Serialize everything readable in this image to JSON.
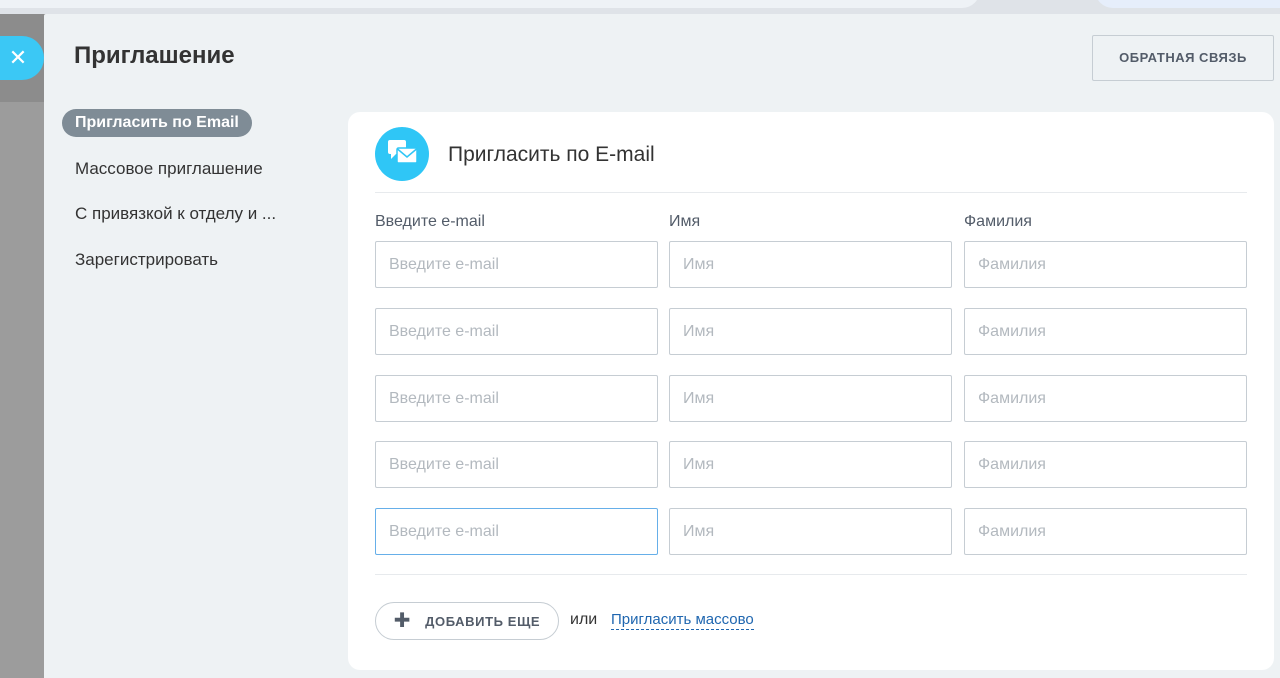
{
  "slider": {
    "title": "Приглашение",
    "feedback_button": "ОБРАТНАЯ СВЯЗЬ"
  },
  "menu": {
    "items": [
      {
        "label": "Пригласить по Email",
        "active": true
      },
      {
        "label": "Массовое приглашение",
        "active": false
      },
      {
        "label": "С привязкой к отделу и ...",
        "active": false
      },
      {
        "label": "Зарегистрировать",
        "active": false
      }
    ]
  },
  "card": {
    "title": "Пригласить по E-mail",
    "icon": "chat-bubble-envelope-icon",
    "columns": {
      "email": "Введите e-mail",
      "name": "Имя",
      "surname": "Фамилия"
    },
    "rows": [
      {
        "email": "",
        "name": "",
        "surname": ""
      },
      {
        "email": "",
        "name": "",
        "surname": ""
      },
      {
        "email": "",
        "name": "",
        "surname": ""
      },
      {
        "email": "",
        "name": "",
        "surname": ""
      },
      {
        "email": "",
        "name": "",
        "surname": ""
      }
    ],
    "placeholders": {
      "email": "Введите e-mail",
      "name": "Имя",
      "surname": "Фамилия"
    },
    "add_more_button": "ДОБАВИТЬ ЕЩЕ",
    "or_text": "или",
    "mass_invite_link": "Пригласить массово"
  },
  "colors": {
    "accent": "#2fc6f6",
    "menu_active_bg": "#7f8c96",
    "link": "#2067b0",
    "focus_border": "#66afe9"
  }
}
